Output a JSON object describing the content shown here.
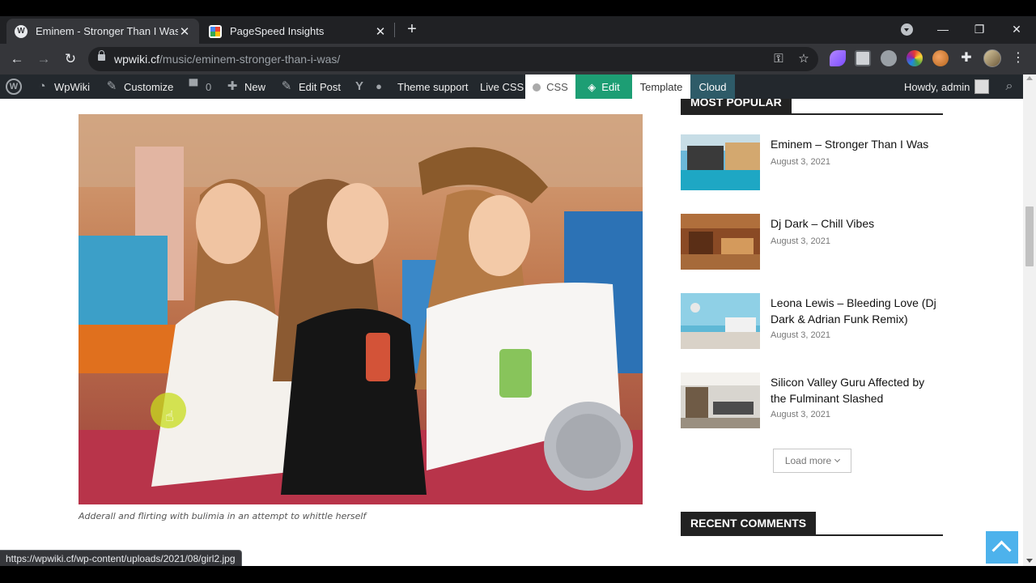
{
  "browser": {
    "tabs": [
      {
        "label": "Eminem - Stronger Than I Was - WpWiki",
        "active": true,
        "icon": "wordpress-icon"
      },
      {
        "label": "PageSpeed Insights",
        "active": false,
        "icon": "pagespeed-icon"
      }
    ],
    "url_host": "wpwiki.cf",
    "url_path": "/music/eminem-stronger-than-i-was/",
    "status_url": "https://wpwiki.cf/wp-content/uploads/2021/08/girl2.jpg"
  },
  "adminbar": {
    "site_name": "WpWiki",
    "customize": "Customize",
    "comments_count": "0",
    "new": "New",
    "edit_post": "Edit Post",
    "theme_support": "Theme support",
    "live_css": "Live CSS",
    "css": "CSS",
    "edit": "Edit",
    "template": "Template",
    "cloud": "Cloud",
    "howdy": "Howdy, admin"
  },
  "article": {
    "caption": "Adderall and flirting with bulimia in an attempt to whittle herself"
  },
  "sidebar": {
    "most_popular_title": "MOST POPULAR",
    "posts": [
      {
        "title": "Eminem – Stronger Than I Was",
        "date": "August 3, 2021"
      },
      {
        "title": "Dj Dark – Chill Vibes",
        "date": "August 3, 2021"
      },
      {
        "title": "Leona Lewis – Bleeding Love (Dj Dark & Adrian Funk Remix)",
        "date": "August 3, 2021"
      },
      {
        "title": "Silicon Valley Guru Affected by the Fulminant Slashed",
        "date": "August 3, 2021"
      }
    ],
    "load_more": "Load more",
    "recent_comments_title": "RECENT COMMENTS"
  },
  "colors": {
    "accent_green": "#1d9e74",
    "cloud_teal": "#2e5b68",
    "totop_blue": "#4db2ec",
    "adminbar_bg": "#23282d"
  }
}
